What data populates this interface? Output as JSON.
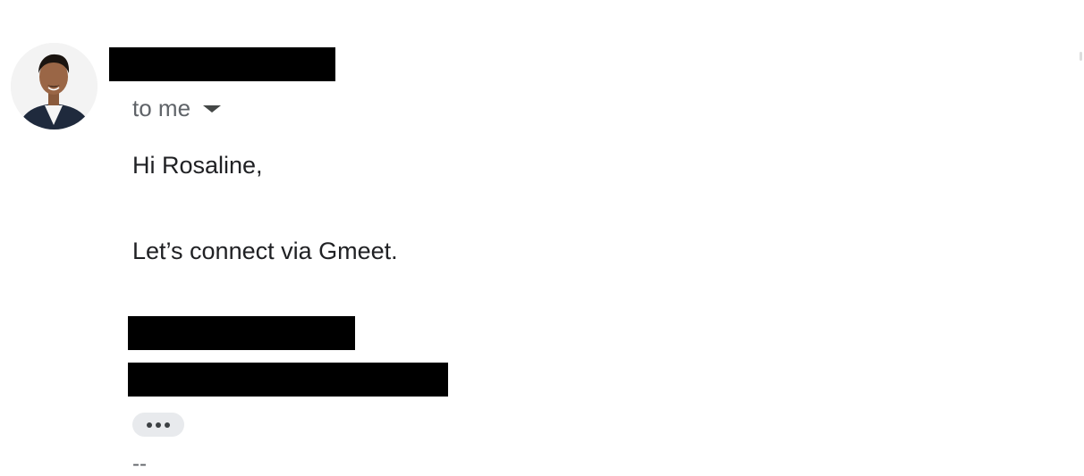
{
  "email": {
    "sender": {
      "avatar_icon": "person-avatar-icon",
      "name_redacted": true
    },
    "recipient": {
      "label": "to me",
      "dropdown_icon": "caret-down-icon"
    },
    "body": {
      "greeting": "Hi Rosaline,",
      "message": "Let’s connect via Gmeet."
    },
    "signature": {
      "lines_redacted": 2,
      "show_trimmed_icon": "more-horizontal-icon",
      "separator": "--"
    }
  },
  "colors": {
    "text": "#202124",
    "secondary_text": "#5f6368",
    "redaction": "#000000",
    "chip_background": "#e8eaed"
  }
}
